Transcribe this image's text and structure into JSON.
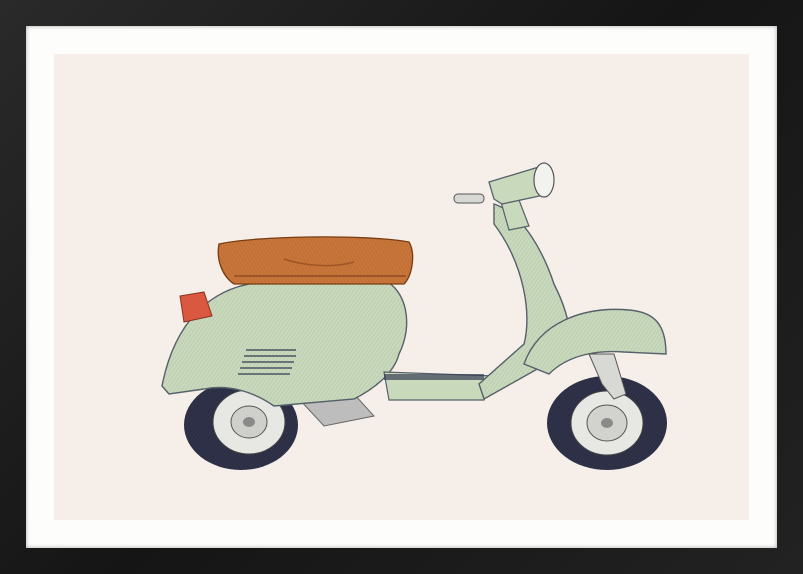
{
  "artwork": {
    "subject": "scooter-illustration",
    "colors": {
      "frame": "#1b1b1b",
      "mat": "#fdfdfb",
      "paper": "#f6efe9",
      "body": "#c9d9bb",
      "body_shadow": "#a9bf98",
      "seat": "#c8753a",
      "seat_dark": "#9e5525",
      "tail_light": "#d9583f",
      "tire": "#2c2e45",
      "rim": "#e8e8e8",
      "outline": "#55606a"
    }
  }
}
